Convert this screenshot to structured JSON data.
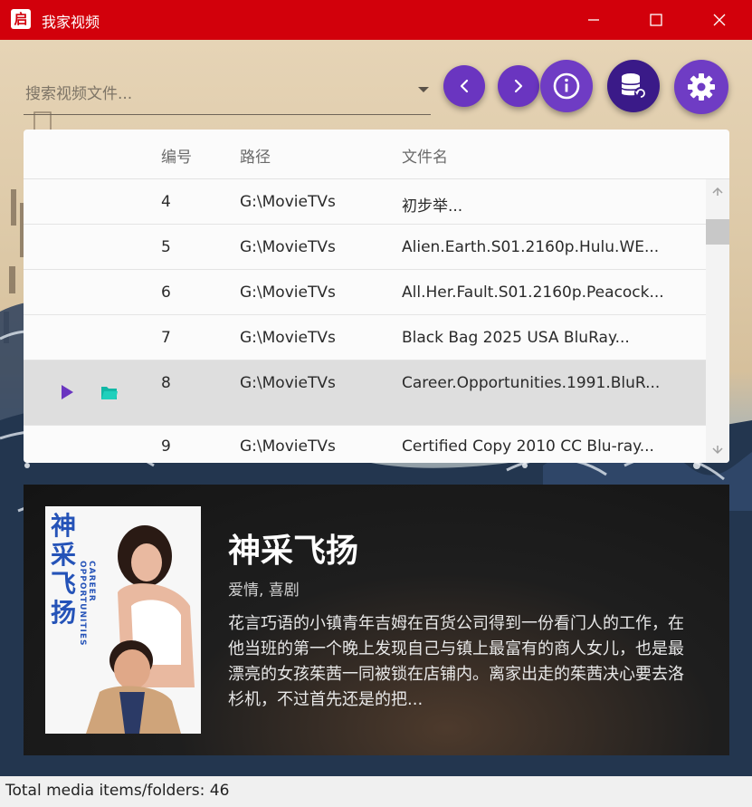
{
  "window": {
    "title": "我家视频",
    "app_icon_glyph": "启",
    "accent_color": "#d2000b"
  },
  "search": {
    "placeholder": "搜索视频文件...",
    "value": ""
  },
  "toolbar": {
    "prev_icon": "chevron-left-icon",
    "next_icon": "chevron-right-icon",
    "info_icon": "info-icon",
    "database_icon": "database-refresh-icon",
    "settings_icon": "gear-icon"
  },
  "table": {
    "headers": [
      "编号",
      "路径",
      "文件名"
    ],
    "rows": [
      {
        "num": "4",
        "path": "G:\\MovieTVs",
        "name": "初步举..."
      },
      {
        "num": "5",
        "path": "G:\\MovieTVs",
        "name": "Alien.Earth.S01.2160p.Hulu.WE..."
      },
      {
        "num": "6",
        "path": "G:\\MovieTVs",
        "name": "All.Her.Fault.S01.2160p.Peacock..."
      },
      {
        "num": "7",
        "path": "G:\\MovieTVs",
        "name": "Black Bag 2025 USA BluRay..."
      },
      {
        "num": "8",
        "path": "G:\\MovieTVs",
        "name": "Career.Opportunities.1991.BluR..."
      },
      {
        "num": "9",
        "path": "G:\\MovieTVs",
        "name": "Certified Copy 2010 CC Blu-ray..."
      }
    ],
    "selected_row_index": 4,
    "row_actions": {
      "play_icon": "play-icon",
      "folder_icon": "folder-open-icon"
    }
  },
  "detail": {
    "title": "神采飞扬",
    "genre": "爱情, 喜剧",
    "description": "花言巧语的小镇青年吉姆在百货公司得到一份看门人的工作，在他当班的第一个晚上发现自己与镇上最富有的商人女儿，也是最漂亮的女孩茱茜一同被锁在店铺内。离家出走的茱茜决心要去洛杉机，不过首先还是的把...",
    "poster_title": "神采飞扬",
    "poster_subtitle": "CAREER OPPORTUNITIES"
  },
  "status": {
    "text": "Total media items/folders: 46"
  }
}
